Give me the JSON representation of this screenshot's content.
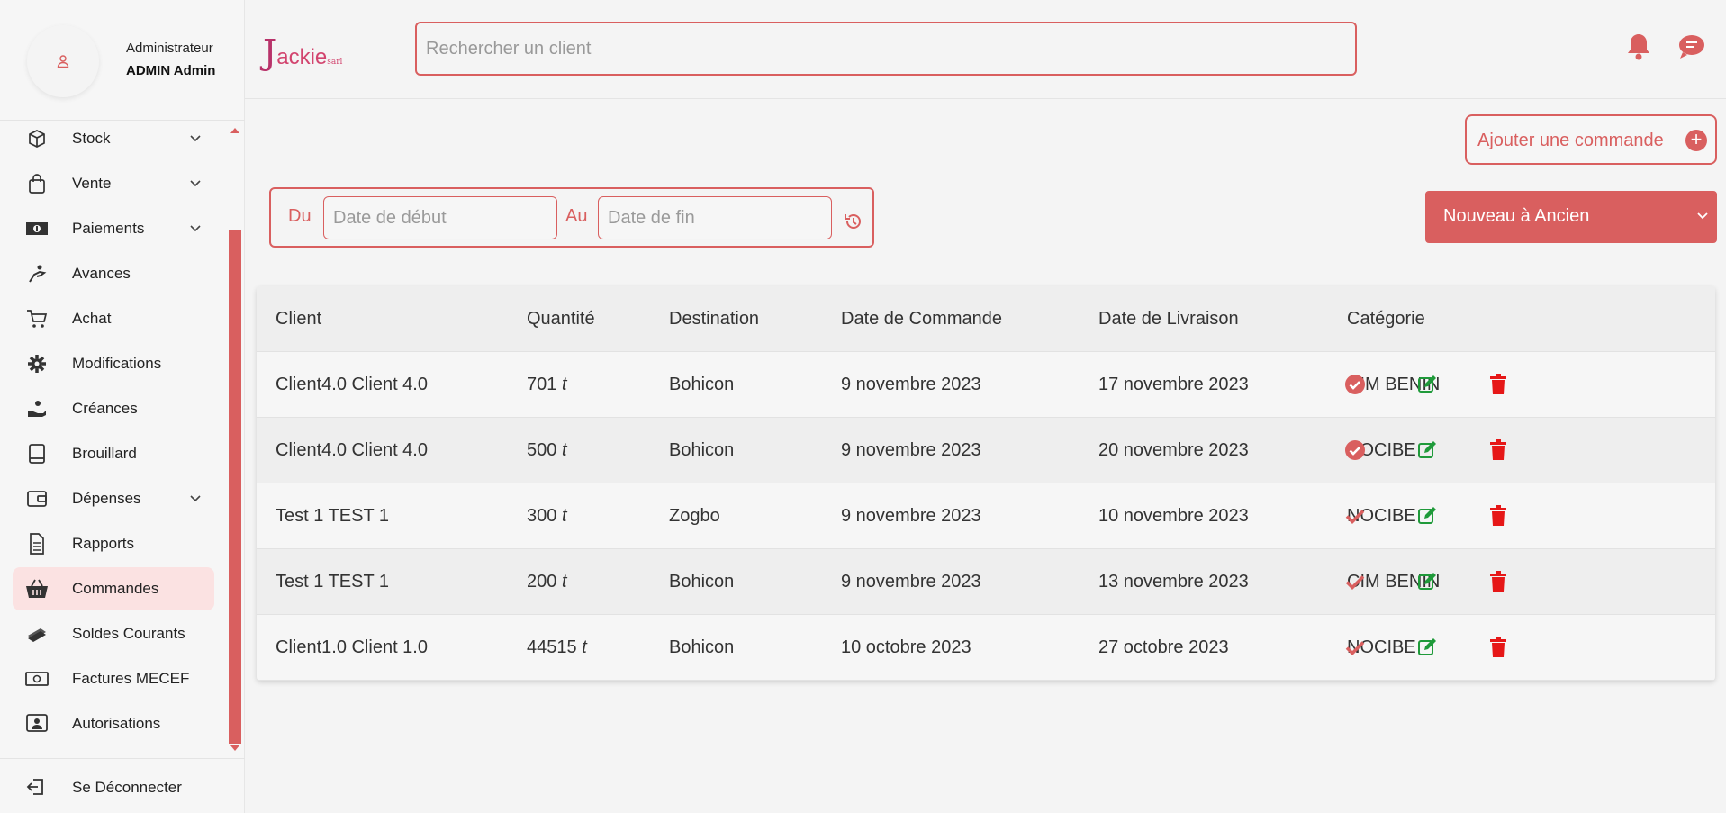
{
  "user": {
    "role": "Administrateur",
    "name": "ADMIN Admin"
  },
  "brand": {
    "logo_initial": "J",
    "logo_rest": "ackie",
    "logo_suffix": "sarl",
    "accent": "#d95f5f"
  },
  "search": {
    "placeholder": "Rechercher un client",
    "value": ""
  },
  "sidebar": {
    "items": [
      {
        "label": "Stock",
        "icon": "box-icon",
        "has_submenu": true
      },
      {
        "label": "Vente",
        "icon": "shopping-bag-icon",
        "has_submenu": true
      },
      {
        "label": "Paiements",
        "icon": "money-bill-icon",
        "has_submenu": true
      },
      {
        "label": "Avances",
        "icon": "hand-coin-icon",
        "has_submenu": false
      },
      {
        "label": "Achat",
        "icon": "cart-icon",
        "has_submenu": false
      },
      {
        "label": "Modifications",
        "icon": "gear-icon",
        "has_submenu": false
      },
      {
        "label": "Créances",
        "icon": "hand-holding-icon",
        "has_submenu": false
      },
      {
        "label": "Brouillard",
        "icon": "book-icon",
        "has_submenu": false
      },
      {
        "label": "Dépenses",
        "icon": "wallet-icon",
        "has_submenu": true
      },
      {
        "label": "Rapports",
        "icon": "file-icon",
        "has_submenu": false
      },
      {
        "label": "Commandes",
        "icon": "basket-icon",
        "has_submenu": false,
        "active": true
      },
      {
        "label": "Soldes Courants",
        "icon": "money-stack-icon",
        "has_submenu": false
      },
      {
        "label": "Factures MECEF",
        "icon": "money-bill-icon",
        "has_submenu": false
      },
      {
        "label": "Autorisations",
        "icon": "user-screen-icon",
        "has_submenu": false
      }
    ],
    "logout": "Se Déconnecter"
  },
  "actions": {
    "add_order": "Ajouter une commande"
  },
  "filters": {
    "from_label": "Du",
    "to_label": "Au",
    "start_placeholder": "Date de début",
    "end_placeholder": "Date de fin",
    "sort_selected": "Nouveau à Ancien"
  },
  "table": {
    "headers": [
      "Client",
      "Quantité",
      "Destination",
      "Date de Commande",
      "Date de Livraison",
      "Catégorie"
    ],
    "rows": [
      {
        "client": "Client4.0 Client 4.0",
        "quantity": "701",
        "unit": "t",
        "destination": "Bohicon",
        "order_date": "9 novembre 2023",
        "delivery_date": "17 novembre 2023",
        "category": "CIM BENIN",
        "status": "validated"
      },
      {
        "client": "Client4.0 Client 4.0",
        "quantity": "500",
        "unit": "t",
        "destination": "Bohicon",
        "order_date": "9 novembre 2023",
        "delivery_date": "20 novembre 2023",
        "category": "NOCIBE",
        "status": "validated"
      },
      {
        "client": "Test 1 TEST 1",
        "quantity": "300",
        "unit": "t",
        "destination": "Zogbo",
        "order_date": "9 novembre 2023",
        "delivery_date": "10 novembre 2023",
        "category": "NOCIBE",
        "status": "pending"
      },
      {
        "client": "Test 1 TEST 1",
        "quantity": "200",
        "unit": "t",
        "destination": "Bohicon",
        "order_date": "9 novembre 2023",
        "delivery_date": "13 novembre 2023",
        "category": "CIM BENIN",
        "status": "pending"
      },
      {
        "client": "Client1.0 Client 1.0",
        "quantity": "44515",
        "unit": "t",
        "destination": "Bohicon",
        "order_date": "10 octobre 2023",
        "delivery_date": "27 octobre 2023",
        "category": "NOCIBE",
        "status": "pending"
      }
    ]
  }
}
